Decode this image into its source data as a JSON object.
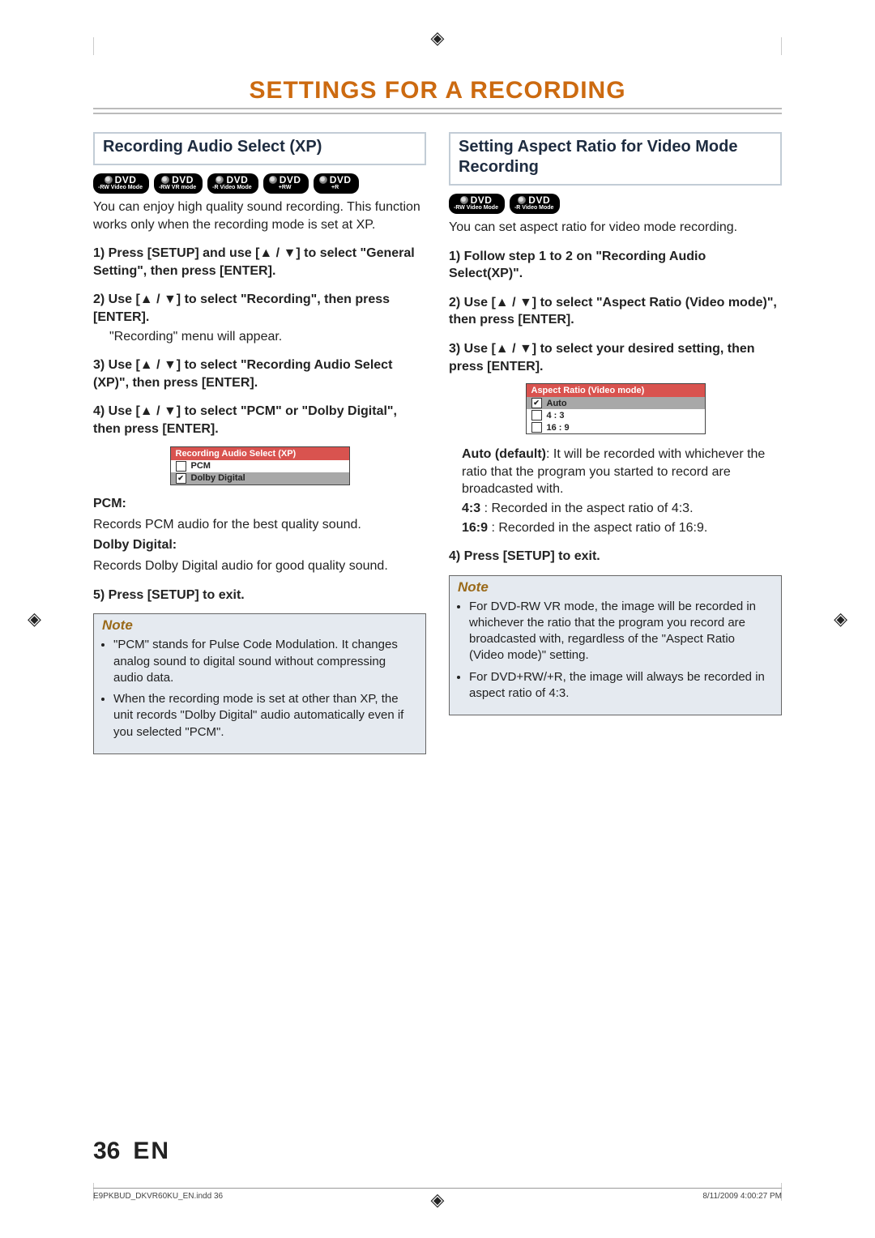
{
  "pageTitle": "SETTINGS FOR A RECORDING",
  "left": {
    "sectionTitle": "Recording Audio Select (XP)",
    "discs": [
      "DVD -RW Video Mode",
      "DVD -RW VR mode",
      "DVD -R Video Mode",
      "DVD +RW",
      "DVD +R"
    ],
    "intro": "You can enjoy high quality sound recording. This function works only when the recording mode is set at XP.",
    "step1": "1) Press [SETUP] and use [▲ / ▼] to select \"General Setting\", then press [ENTER].",
    "step2": "2) Use [▲ / ▼] to select \"Recording\", then press [ENTER].",
    "step2After": "\"Recording\" menu will appear.",
    "step3": "3) Use [▲ / ▼] to select \"Recording Audio Select (XP)\", then press [ENTER].",
    "step4": "4) Use [▲ / ▼] to select \"PCM\" or \"Dolby Digital\", then press [ENTER].",
    "menu": {
      "header": "Recording Audio Select (XP)",
      "items": [
        {
          "label": "PCM",
          "checked": false,
          "selected": false
        },
        {
          "label": "Dolby Digital",
          "checked": true,
          "selected": true
        }
      ]
    },
    "pcmHead": "PCM:",
    "pcmBody": "Records PCM audio for the best quality sound.",
    "ddHead": "Dolby Digital:",
    "ddBody": "Records Dolby Digital audio for good quality sound.",
    "step5": "5) Press [SETUP] to exit.",
    "noteTitle": "Note",
    "notes": [
      "\"PCM\" stands for Pulse Code Modulation. It changes analog sound to digital sound without compressing audio data.",
      "When the recording mode is set at other than XP, the unit records \"Dolby Digital\" audio automatically even if you selected \"PCM\"."
    ]
  },
  "right": {
    "sectionTitle": "Setting Aspect Ratio for Video Mode Recording",
    "discs": [
      "DVD -RW Video Mode",
      "DVD -R Video Mode"
    ],
    "intro": "You can set aspect ratio for video mode recording.",
    "step1": "1) Follow step 1 to 2 on \"Recording Audio Select(XP)\".",
    "step2": "2) Use [▲ / ▼] to select \"Aspect Ratio (Video mode)\", then press [ENTER].",
    "step3": "3) Use [▲ / ▼] to select your desired setting, then press [ENTER].",
    "menu": {
      "header": "Aspect Ratio (Video mode)",
      "items": [
        {
          "label": "Auto",
          "checked": true,
          "selected": true
        },
        {
          "label": "4 : 3",
          "checked": false,
          "selected": false
        },
        {
          "label": "16 : 9",
          "checked": false,
          "selected": false
        }
      ]
    },
    "autoLabel": "Auto (default)",
    "autoBody": ": It will be recorded with whichever the ratio that the program you started to record are broadcasted with.",
    "r43Label": "4:3",
    "r43Body": ": Recorded in the aspect ratio of 4:3.",
    "r169Label": "16:9",
    "r169Body": ": Recorded in the aspect ratio of 16:9.",
    "step4": "4) Press [SETUP] to exit.",
    "noteTitle": "Note",
    "notes": [
      "For DVD-RW VR mode, the image will be recorded in whichever the ratio that the program you record are broadcasted with, regardless of the \"Aspect Ratio (Video mode)\" setting.",
      "For DVD+RW/+R, the image will always be recorded in aspect ratio of 4:3."
    ]
  },
  "footer": {
    "pageNum": "36",
    "lang": "EN",
    "inddFile": "E9PKBUD_DKVR60KU_EN.indd   36",
    "timestamp": "8/11/2009   4:00:27 PM"
  }
}
